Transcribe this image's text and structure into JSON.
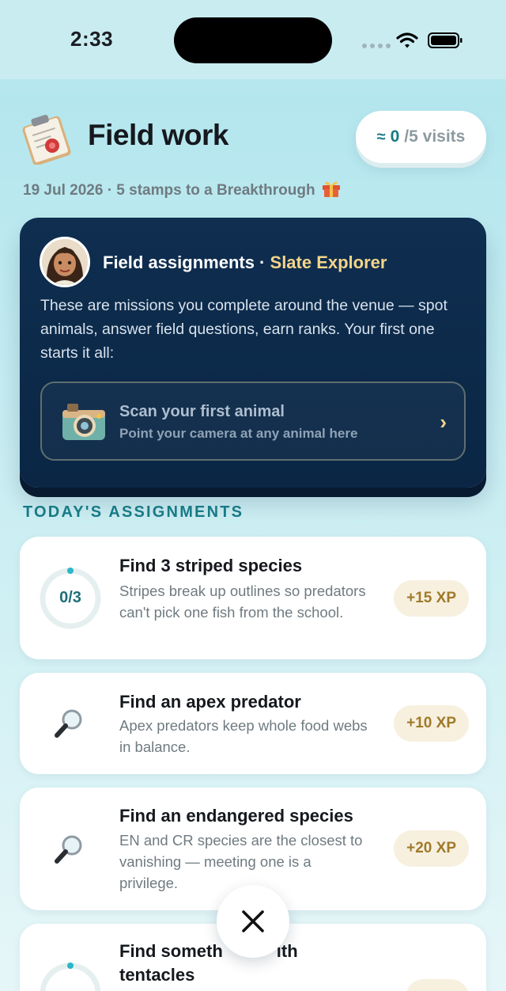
{
  "status_bar": {
    "time": "2:33"
  },
  "header": {
    "title": "Field work",
    "visits": {
      "approx": "≈",
      "count": "0",
      "total": "/5 visits"
    },
    "subtitle": "19 Jul 2026 · 5 stamps to a Breakthrough"
  },
  "assign_card": {
    "heading": "Field assignments ·",
    "rank": "Slate Explorer",
    "description": "These are missions you complete around the venue — spot animals, answer field questions, earn ranks. Your first one starts it all:",
    "scan": {
      "title": "Scan your first animal",
      "subtitle": "Point your camera at any animal here",
      "chevron": "›"
    }
  },
  "section_label": "TODAY'S ASSIGNMENTS",
  "tasks": [
    {
      "title": "Find 3 striped species",
      "description": "Stripes break up outlines so predators can't pick one fish from the school.",
      "xp": "+15 XP",
      "progress": "0/3"
    },
    {
      "title": "Find an apex predator",
      "description": "Apex predators keep whole food webs in balance.",
      "xp": "+10 XP"
    },
    {
      "title": "Find an endangered species",
      "description": "EN and CR species are the closest to vanishing — meeting one is a privilege.",
      "xp": "+20 XP"
    },
    {
      "title_line1": "Find someth",
      "title_line1_end": "ith",
      "title_line2": "tentacles"
    }
  ],
  "colors": {
    "accent": "#177a86",
    "card_dark": "#0f2e50",
    "gold": "#f4d58a",
    "xp_bg": "#f7f0df"
  },
  "icons": [
    "clipboard-icon",
    "gift-icon",
    "avatar-explorer",
    "camera-icon",
    "magnifier-icon",
    "close-icon",
    "wifi-icon",
    "battery-icon"
  ]
}
